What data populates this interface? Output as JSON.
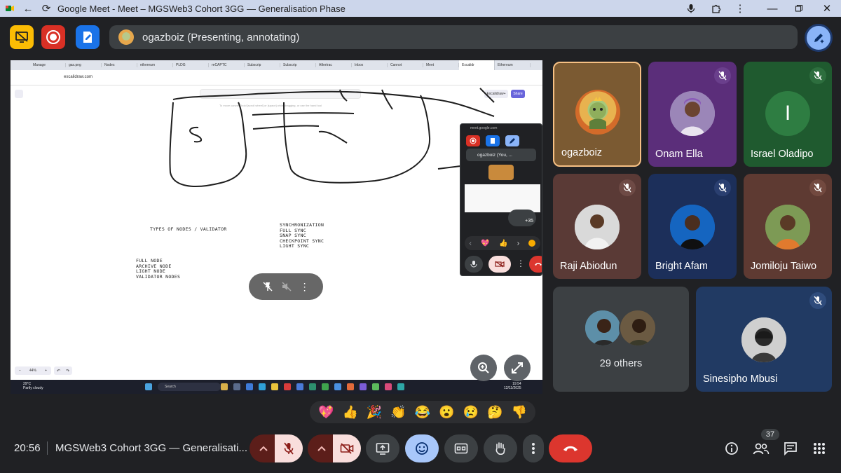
{
  "window": {
    "title": "Google Meet - Meet – MGSWeb3 Cohort 3GG — Generalisation Phase"
  },
  "presenter_bar": {
    "label": "ogazboiz (Presenting, annotating)"
  },
  "shared_screen": {
    "browser_tabs": [
      "Manage",
      "gas.png",
      "Nodes",
      "ethereum",
      "PLDG",
      "reCAPTC",
      "Subscrip",
      "Subscrip",
      "Aftertrac",
      "Inbox",
      "Cannot",
      "Meet",
      "Excalidr",
      "Ethereum"
    ],
    "address": "excalidraw.com",
    "library_label": "Excalidraw+",
    "share_label": "Share",
    "toolbar_hint": "To move canvas, hold [scroll wheel] or [space] while dragging, or use the hand tool",
    "types_heading": "TYPES OF NODES / VALIDATOR",
    "sync_list": [
      "SYNCHRONIZATION",
      "FULL SYNC",
      "SNAP SYNC",
      "CHECKPOINT SYNC",
      "LIGHT SYNC"
    ],
    "node_list": [
      "FULL NODE",
      "ARCHIVE NODE",
      "LIGHT NODE",
      "VALIDATOR NODES"
    ],
    "zoom_level": "44%",
    "taskbar": {
      "temperature": "29°C",
      "weather": "Partly cloudy",
      "search_placeholder": "Search",
      "time": "19:54",
      "date": "12/11/2025"
    },
    "mini_meet": {
      "url": "meet.google.com",
      "presenter_label": "ogazboiz (You, ...",
      "more_count": "+35"
    }
  },
  "participants": [
    {
      "name": "ogazboiz",
      "muted": false,
      "active_speaker": true
    },
    {
      "name": "Onam Ella",
      "muted": true
    },
    {
      "name": "Israel Oladipo",
      "muted": true,
      "initial": "I"
    },
    {
      "name": "Raji Abiodun",
      "muted": true
    },
    {
      "name": "Bright Afam",
      "muted": true
    },
    {
      "name": "Jomiloju Taiwo",
      "muted": true
    },
    {
      "name": "Sinesipho Mbusi",
      "muted": true
    }
  ],
  "others": {
    "label": "29 others"
  },
  "reactions": [
    "💖",
    "👍",
    "🎉",
    "👏",
    "😂",
    "😮",
    "😢",
    "🤔",
    "👎"
  ],
  "bottom_bar": {
    "time": "20:56",
    "meeting_title": "MGSWeb3 Cohort 3GG — Generalisati...",
    "people_count": "37"
  },
  "colors": {
    "background": "#202124",
    "end_call": "#dc362e",
    "active_speaker_border": "#f6c084",
    "accent_blue": "#a8c7fa"
  }
}
